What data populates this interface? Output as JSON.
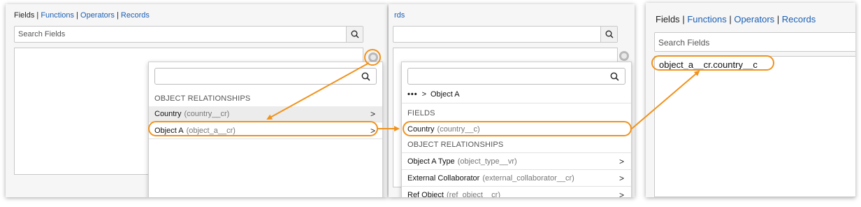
{
  "panel1": {
    "tabs": {
      "fields": "Fields",
      "sep1": "|",
      "functions": "Functions",
      "sep2": "|",
      "operators": "Operators",
      "sep3": "|",
      "records": "Records"
    },
    "search_placeholder": "Search Fields",
    "dropdown": {
      "section_label": "OBJECT RELATIONSHIPS",
      "items": [
        {
          "label": "Country",
          "api": "(country__cr)",
          "chevron": ">"
        },
        {
          "label": "Object A",
          "api": "(object_a__cr)",
          "chevron": ">"
        }
      ]
    }
  },
  "panel2": {
    "tabs_fragment": "rds",
    "dropdown": {
      "breadcrumb": {
        "dots": "•••",
        "sep": ">",
        "current": "Object A"
      },
      "fields_label": "FIELDS",
      "field_items": [
        {
          "label": "Country",
          "api": "(country__c)"
        }
      ],
      "relationships_label": "OBJECT RELATIONSHIPS",
      "relationship_items": [
        {
          "label": "Object A Type",
          "api": "(object_type__vr)",
          "chevron": ">"
        },
        {
          "label": "External Collaborator",
          "api": "(external_collaborator__cr)",
          "chevron": ">"
        },
        {
          "label": "Ref Object",
          "api": "(ref_object__cr)",
          "chevron": ">"
        }
      ]
    }
  },
  "panel3": {
    "tabs": {
      "fields": "Fields",
      "sep1": "|",
      "functions": "Functions",
      "sep2": "|",
      "operators": "Operators",
      "sep3": "|",
      "records": "Records"
    },
    "search_placeholder": "Search Fields",
    "result": "object_a__cr.country__c"
  },
  "colors": {
    "highlight": "#f0921c",
    "link": "#1a5fb4"
  },
  "icons": [
    "search-icon",
    "field-picker-icon",
    "chevron-right-icon"
  ]
}
